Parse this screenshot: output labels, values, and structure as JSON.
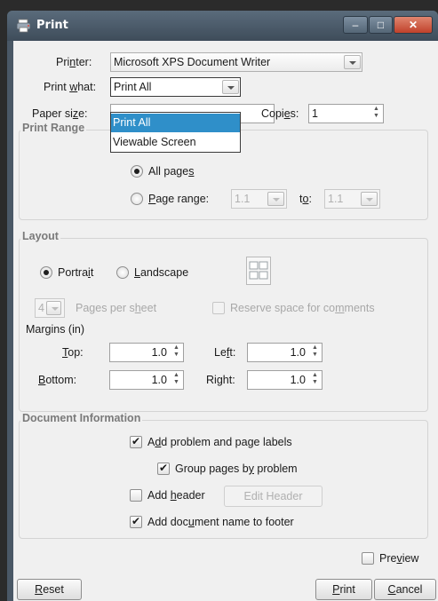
{
  "window": {
    "title": "Print",
    "controls": {
      "minimize": "–",
      "maximize": "□",
      "close": "✕"
    }
  },
  "printer": {
    "label_pre": "Pri",
    "label_acc": "n",
    "label_post": "ter:",
    "value": "Microsoft XPS Document Writer"
  },
  "print_what": {
    "label_pre": "Print ",
    "label_acc": "w",
    "label_post": "hat:",
    "value": "Print All",
    "options": [
      "Print All",
      "Viewable Screen"
    ],
    "highlighted": "Print All"
  },
  "paper_size": {
    "label_pre": "Paper si",
    "label_acc": "z",
    "label_post": "e:"
  },
  "copies": {
    "label_pre": "Copi",
    "label_acc": "e",
    "label_post": "s:",
    "value": "1"
  },
  "print_range": {
    "title": "Print Range",
    "all_pages": {
      "pre": "All page",
      "acc": "s",
      "post": "",
      "selected": true
    },
    "page_range": {
      "pre": "",
      "acc": "P",
      "post": "age range:",
      "selected": false,
      "from": "1.1",
      "to_pre": "t",
      "to_acc": "o",
      "to_post": ":",
      "to": "1.1"
    }
  },
  "layout": {
    "title": "Layout",
    "portrait": {
      "pre": "Portra",
      "acc": "i",
      "post": "t",
      "selected": true
    },
    "landscape": {
      "pre": "",
      "acc": "L",
      "post": "andscape",
      "selected": false
    },
    "pages_per_sheet": {
      "value": "4",
      "pre": "Pages per s",
      "acc": "h",
      "post": "eet"
    },
    "reserve_space": {
      "pre": "Reserve space for co",
      "acc": "m",
      "post": "ments",
      "checked": false
    },
    "margins_label": "Margins (in)",
    "top": {
      "pre": "",
      "acc": "T",
      "post": "op:",
      "value": "1.0"
    },
    "bottom": {
      "pre": "",
      "acc": "B",
      "post": "ottom:",
      "value": "1.0"
    },
    "left": {
      "pre": "Le",
      "acc": "f",
      "post": "t:",
      "value": "1.0"
    },
    "right": {
      "pre": "Ri",
      "acc": "g",
      "post": "ht:",
      "value": "1.0"
    }
  },
  "document_info": {
    "title": "Document Information",
    "add_labels": {
      "pre": "A",
      "acc": "d",
      "post": "d problem and page labels",
      "checked": true
    },
    "group_pages": {
      "pre": "Group pages b",
      "acc": "y",
      "post": " problem",
      "checked": true
    },
    "add_header": {
      "pre": "Add ",
      "acc": "h",
      "post": "eader",
      "checked": false
    },
    "edit_header": "Edit Header",
    "add_doc_name": {
      "pre": "Add doc",
      "acc": "u",
      "post": "ment name to footer",
      "checked": true
    }
  },
  "preview": {
    "pre": "Pre",
    "acc": "v",
    "post": "iew",
    "checked": false
  },
  "buttons": {
    "reset": {
      "pre": "",
      "acc": "R",
      "post": "eset"
    },
    "print": {
      "pre": "",
      "acc": "P",
      "post": "rint"
    },
    "cancel": {
      "pre": "",
      "acc": "C",
      "post": "ancel"
    }
  }
}
